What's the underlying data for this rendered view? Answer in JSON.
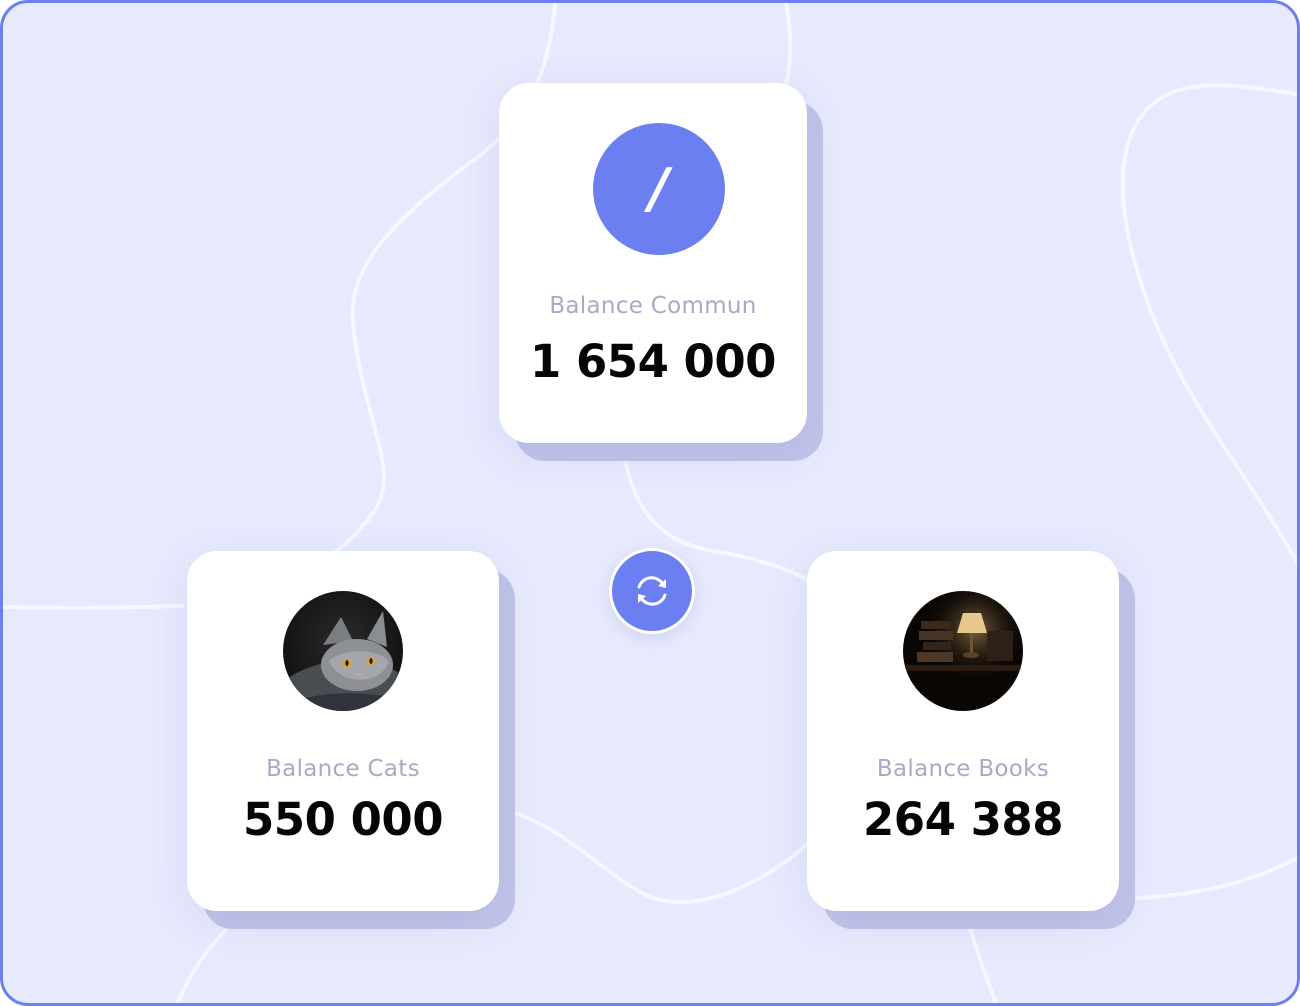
{
  "colors": {
    "accent": "#6b7ff0",
    "background": "#e7eafd",
    "card": "#ffffff",
    "label": "#a7aac3",
    "value": "#050505"
  },
  "cards": {
    "main": {
      "avatar_glyph": "/",
      "label": "Balance Commun",
      "value": "1 654 000"
    },
    "cats": {
      "avatar_icon": "cat-photo",
      "label": "Balance Cats",
      "value": "550 000"
    },
    "books": {
      "avatar_icon": "books-lamp-photo",
      "label": "Balance Books",
      "value": "264 388"
    }
  },
  "sync_button": {
    "icon": "sync-icon"
  }
}
